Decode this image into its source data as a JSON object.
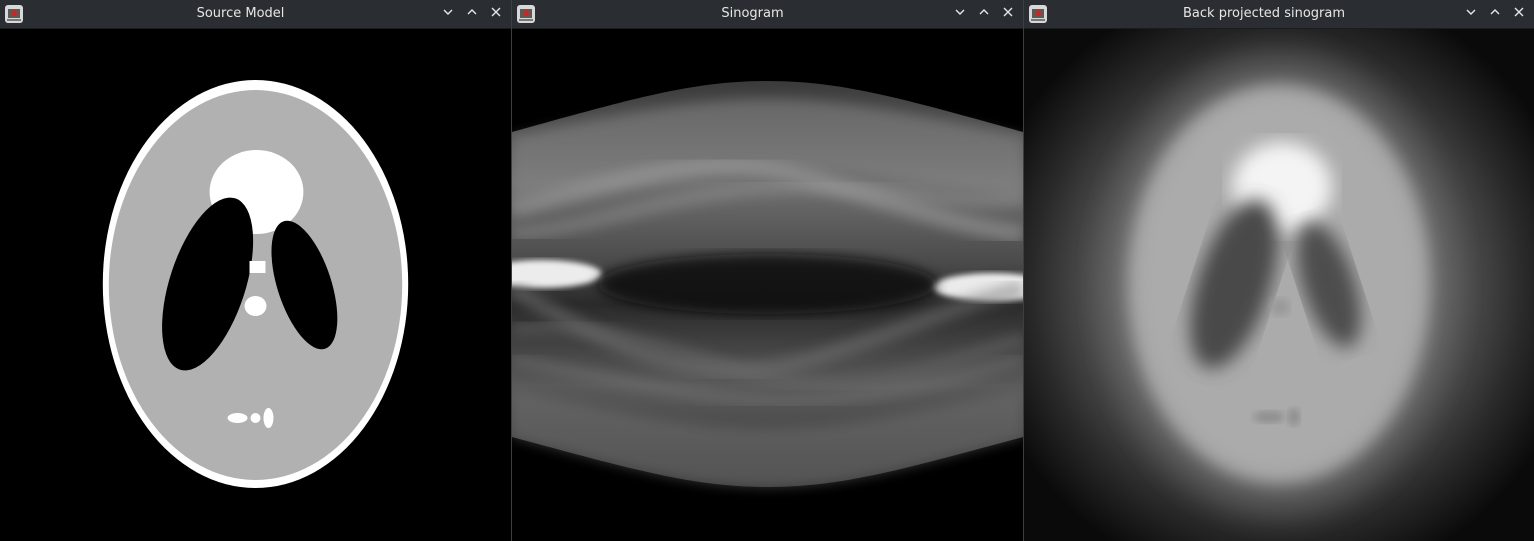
{
  "windows": [
    {
      "title": "Source Model"
    },
    {
      "title": "Sinogram"
    },
    {
      "title": "Back projected sinogram"
    }
  ],
  "titlebar_buttons": {
    "minimize_icon": "chevron-down-icon",
    "maximize_icon": "chevron-up-icon",
    "close_icon": "close-icon"
  },
  "colors": {
    "titlebar": "#2a2e32",
    "title_text": "#e6e6e6",
    "canvas": "#000000"
  }
}
